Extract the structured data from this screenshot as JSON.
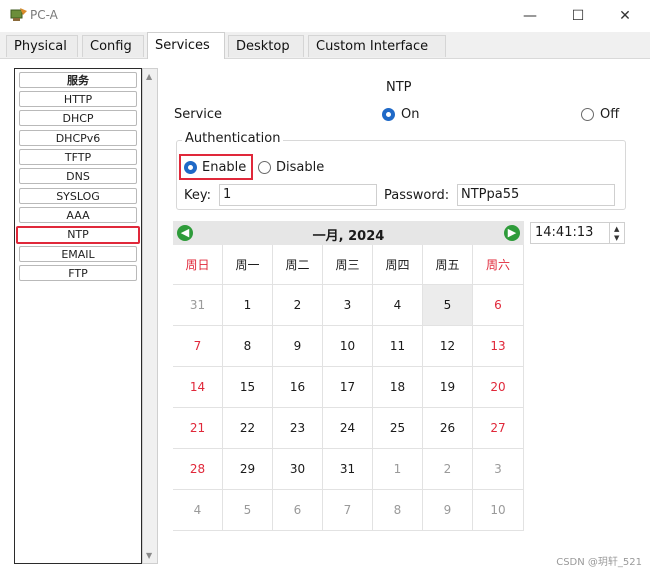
{
  "window": {
    "title": "PC-A",
    "minimize_symbol": "—",
    "maximize_symbol": "☐",
    "close_symbol": "✕"
  },
  "tabs": [
    {
      "label": "Physical",
      "active": false
    },
    {
      "label": "Config",
      "active": false
    },
    {
      "label": "Services",
      "active": true
    },
    {
      "label": "Desktop",
      "active": false
    },
    {
      "label": "Custom Interface",
      "active": false
    }
  ],
  "services": {
    "header": "服务",
    "items": [
      "HTTP",
      "DHCP",
      "DHCPv6",
      "TFTP",
      "DNS",
      "SYSLOG",
      "AAA",
      "NTP",
      "EMAIL",
      "FTP"
    ],
    "selected": "NTP"
  },
  "ntp": {
    "title": "NTP",
    "service_label": "Service",
    "on_label": "On",
    "off_label": "Off",
    "service_state": "On",
    "auth_legend": "Authentication",
    "enable_label": "Enable",
    "disable_label": "Disable",
    "auth_state": "Enable",
    "key_label": "Key:",
    "key_value": "1",
    "password_label": "Password:",
    "password_value": "NTPpa55"
  },
  "calendar": {
    "month_title": "一月, 2024",
    "prev_symbol": "◀",
    "next_symbol": "▶",
    "weekdays": [
      "周日",
      "周一",
      "周二",
      "周三",
      "周四",
      "周五",
      "周六"
    ],
    "weeks": [
      [
        "31",
        "1",
        "2",
        "3",
        "4",
        "5",
        "6"
      ],
      [
        "7",
        "8",
        "9",
        "10",
        "11",
        "12",
        "13"
      ],
      [
        "14",
        "15",
        "16",
        "17",
        "18",
        "19",
        "20"
      ],
      [
        "21",
        "22",
        "23",
        "24",
        "25",
        "26",
        "27"
      ],
      [
        "28",
        "29",
        "30",
        "31",
        "1",
        "2",
        "3"
      ],
      [
        "4",
        "5",
        "6",
        "7",
        "8",
        "9",
        "10"
      ]
    ],
    "today": "5",
    "time": "14:41:13",
    "weekend_color": "#e0283a"
  },
  "watermark": "CSDN @玥轩_521",
  "colors": {
    "accent": "#1f69c7",
    "highlight_border": "#e0283a",
    "nav_green": "#2e9b3a"
  }
}
